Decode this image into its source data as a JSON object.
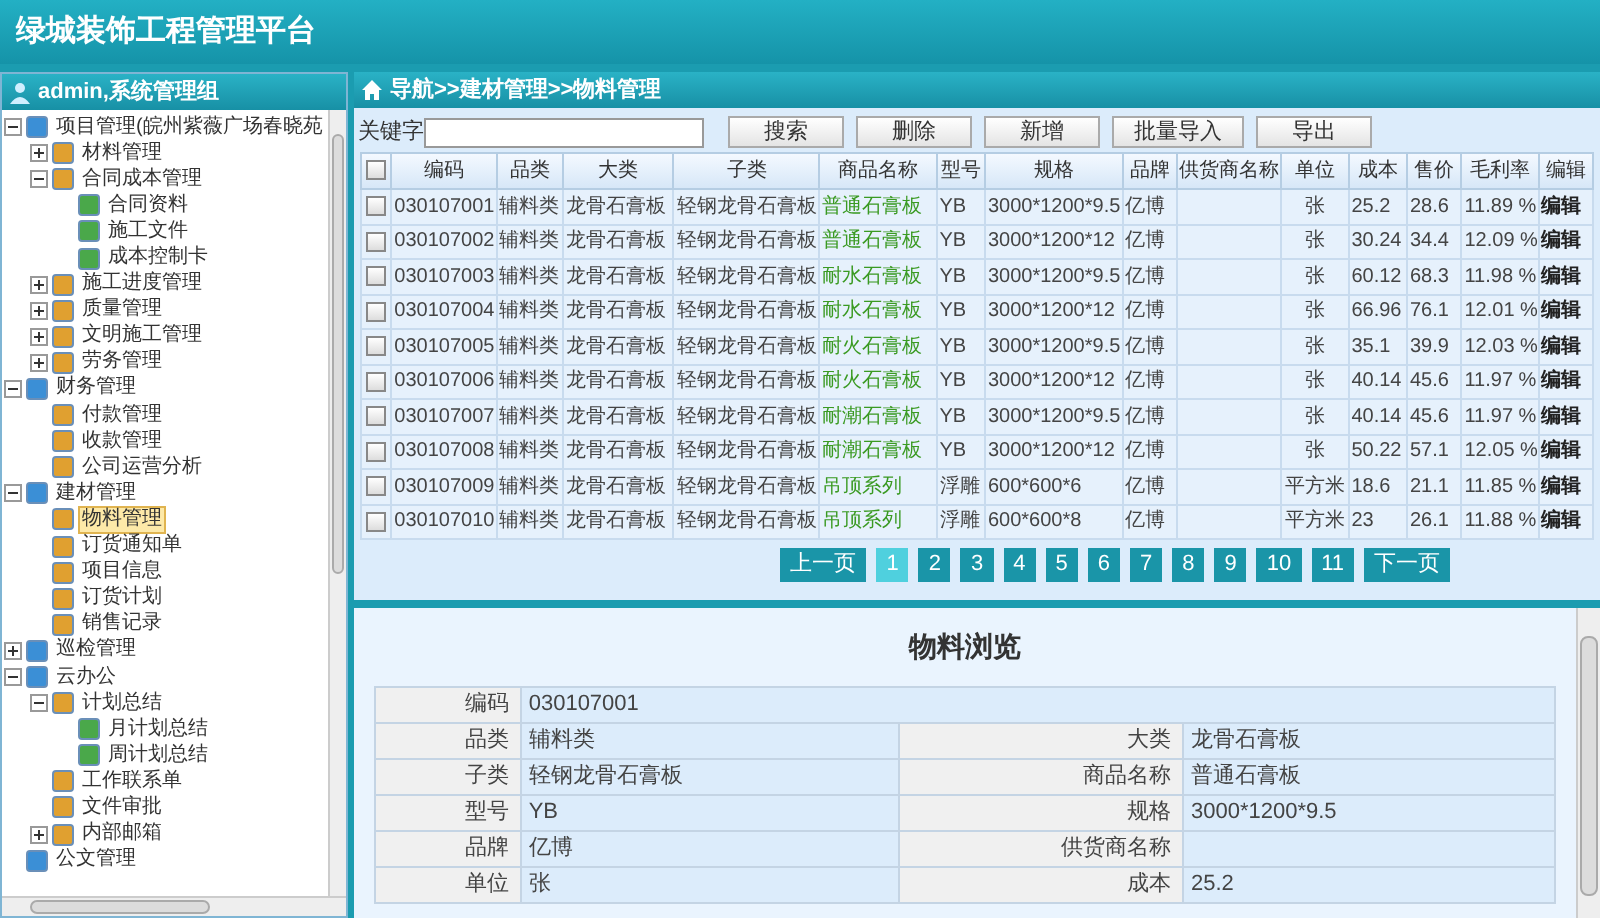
{
  "app_title": "绿城装饰工程管理平台",
  "sidebar": {
    "title": "admin,系统管理组",
    "tree": [
      {
        "label": "项目管理(皖州紫薇广场春晓苑",
        "expanded": true,
        "selected": false,
        "children": [
          {
            "label": "材料管理",
            "expanded": false,
            "selected": false
          },
          {
            "label": "合同成本管理",
            "expanded": true,
            "selected": false,
            "children": [
              {
                "label": "合同资料",
                "selected": false
              },
              {
                "label": "施工文件",
                "selected": false
              },
              {
                "label": "成本控制卡",
                "selected": false
              }
            ]
          },
          {
            "label": "施工进度管理",
            "expanded": false,
            "selected": false
          },
          {
            "label": "质量管理",
            "expanded": false,
            "selected": false
          },
          {
            "label": "文明施工管理",
            "expanded": false,
            "selected": false
          },
          {
            "label": "劳务管理",
            "expanded": false,
            "selected": false
          }
        ]
      },
      {
        "label": "财务管理",
        "expanded": true,
        "selected": false,
        "children": [
          {
            "label": "付款管理",
            "selected": false
          },
          {
            "label": "收款管理",
            "selected": false
          },
          {
            "label": "公司运营分析",
            "selected": false
          }
        ]
      },
      {
        "label": "建材管理",
        "expanded": true,
        "selected": false,
        "children": [
          {
            "label": "物料管理",
            "selected": true
          },
          {
            "label": "订货通知单",
            "selected": false
          },
          {
            "label": "项目信息",
            "selected": false
          },
          {
            "label": "订货计划",
            "selected": false
          },
          {
            "label": "销售记录",
            "selected": false
          }
        ]
      },
      {
        "label": "巡检管理",
        "expanded": false,
        "selected": false
      },
      {
        "label": "云办公",
        "expanded": true,
        "selected": false,
        "children": [
          {
            "label": "计划总结",
            "expanded": true,
            "selected": false,
            "children": [
              {
                "label": "月计划总结",
                "selected": false
              },
              {
                "label": "周计划总结",
                "selected": false
              }
            ]
          },
          {
            "label": "工作联系单",
            "selected": false
          },
          {
            "label": "文件审批",
            "selected": false
          },
          {
            "label": "内部邮箱",
            "expanded": false,
            "selected": false
          }
        ]
      },
      {
        "label": "公文管理",
        "selected": false
      }
    ]
  },
  "breadcrumb": "导航>>建材管理>>物料管理",
  "toolbar": {
    "search_label": "关键字",
    "buttons": [
      "搜索",
      "删除",
      "新增",
      "批量导入",
      "导出"
    ]
  },
  "table": {
    "columns": [
      "编码",
      "品类",
      "大类",
      "子类",
      "商品名称",
      "型号",
      "规格",
      "品牌",
      "供货商名称",
      "单位",
      "成本",
      "售价",
      "毛利率",
      "编辑"
    ],
    "header_checked": false,
    "rows": [
      {
        "checked": false,
        "cells": [
          "030107001",
          "辅料类",
          "龙骨石膏板",
          "轻钢龙骨石膏板",
          "普通石膏板",
          "YB",
          "3000*1200*9.5",
          "亿博",
          "",
          "张",
          "25.2",
          "28.6",
          "11.89 %",
          "编辑"
        ]
      },
      {
        "checked": false,
        "cells": [
          "030107002",
          "辅料类",
          "龙骨石膏板",
          "轻钢龙骨石膏板",
          "普通石膏板",
          "YB",
          "3000*1200*12",
          "亿博",
          "",
          "张",
          "30.24",
          "34.4",
          "12.09 %",
          "编辑"
        ]
      },
      {
        "checked": false,
        "cells": [
          "030107003",
          "辅料类",
          "龙骨石膏板",
          "轻钢龙骨石膏板",
          "耐水石膏板",
          "YB",
          "3000*1200*9.5",
          "亿博",
          "",
          "张",
          "60.12",
          "68.3",
          "11.98 %",
          "编辑"
        ]
      },
      {
        "checked": false,
        "cells": [
          "030107004",
          "辅料类",
          "龙骨石膏板",
          "轻钢龙骨石膏板",
          "耐水石膏板",
          "YB",
          "3000*1200*12",
          "亿博",
          "",
          "张",
          "66.96",
          "76.1",
          "12.01 %",
          "编辑"
        ]
      },
      {
        "checked": false,
        "cells": [
          "030107005",
          "辅料类",
          "龙骨石膏板",
          "轻钢龙骨石膏板",
          "耐火石膏板",
          "YB",
          "3000*1200*9.5",
          "亿博",
          "",
          "张",
          "35.1",
          "39.9",
          "12.03 %",
          "编辑"
        ]
      },
      {
        "checked": false,
        "cells": [
          "030107006",
          "辅料类",
          "龙骨石膏板",
          "轻钢龙骨石膏板",
          "耐火石膏板",
          "YB",
          "3000*1200*12",
          "亿博",
          "",
          "张",
          "40.14",
          "45.6",
          "11.97 %",
          "编辑"
        ]
      },
      {
        "checked": false,
        "cells": [
          "030107007",
          "辅料类",
          "龙骨石膏板",
          "轻钢龙骨石膏板",
          "耐潮石膏板",
          "YB",
          "3000*1200*9.5",
          "亿博",
          "",
          "张",
          "40.14",
          "45.6",
          "11.97 %",
          "编辑"
        ]
      },
      {
        "checked": false,
        "cells": [
          "030107008",
          "辅料类",
          "龙骨石膏板",
          "轻钢龙骨石膏板",
          "耐潮石膏板",
          "YB",
          "3000*1200*12",
          "亿博",
          "",
          "张",
          "50.22",
          "57.1",
          "12.05 %",
          "编辑"
        ]
      },
      {
        "checked": false,
        "cells": [
          "030107009",
          "辅料类",
          "龙骨石膏板",
          "轻钢龙骨石膏板",
          "吊顶系列",
          "浮雕",
          "600*600*6",
          "亿博",
          "",
          "平方米",
          "18.6",
          "21.1",
          "11.85 %",
          "编辑"
        ]
      },
      {
        "checked": false,
        "cells": [
          "030107010",
          "辅料类",
          "龙骨石膏板",
          "轻钢龙骨石膏板",
          "吊顶系列",
          "浮雕",
          "600*600*8",
          "亿博",
          "",
          "平方米",
          "23",
          "26.1",
          "11.88 %",
          "编辑"
        ]
      }
    ]
  },
  "pagination": {
    "prev": "上一页",
    "next": "下一页",
    "pages": [
      {
        "label": "1",
        "selected": true
      },
      {
        "label": "2",
        "selected": false
      },
      {
        "label": "3",
        "selected": false
      },
      {
        "label": "4",
        "selected": false
      },
      {
        "label": "5",
        "selected": false
      },
      {
        "label": "6",
        "selected": false
      },
      {
        "label": "7",
        "selected": false
      },
      {
        "label": "8",
        "selected": false
      },
      {
        "label": "9",
        "selected": false
      },
      {
        "label": "10",
        "selected": false
      },
      {
        "label": "11",
        "selected": false
      }
    ]
  },
  "detail": {
    "title": "物料浏览",
    "rows": [
      [
        {
          "label": "编码",
          "value": "030107001"
        }
      ],
      [
        {
          "label": "品类",
          "value": "辅料类"
        },
        {
          "label": "大类",
          "value": "龙骨石膏板"
        }
      ],
      [
        {
          "label": "子类",
          "value": "轻钢龙骨石膏板"
        },
        {
          "label": "商品名称",
          "value": "普通石膏板"
        }
      ],
      [
        {
          "label": "型号",
          "value": "YB"
        },
        {
          "label": "规格",
          "value": "3000*1200*9.5"
        }
      ],
      [
        {
          "label": "品牌",
          "value": "亿博"
        },
        {
          "label": "供货商名称"
        }
      ],
      [
        {
          "label": "单位",
          "value": "张"
        },
        {
          "label": "成本",
          "value": "25.2"
        }
      ]
    ]
  }
}
